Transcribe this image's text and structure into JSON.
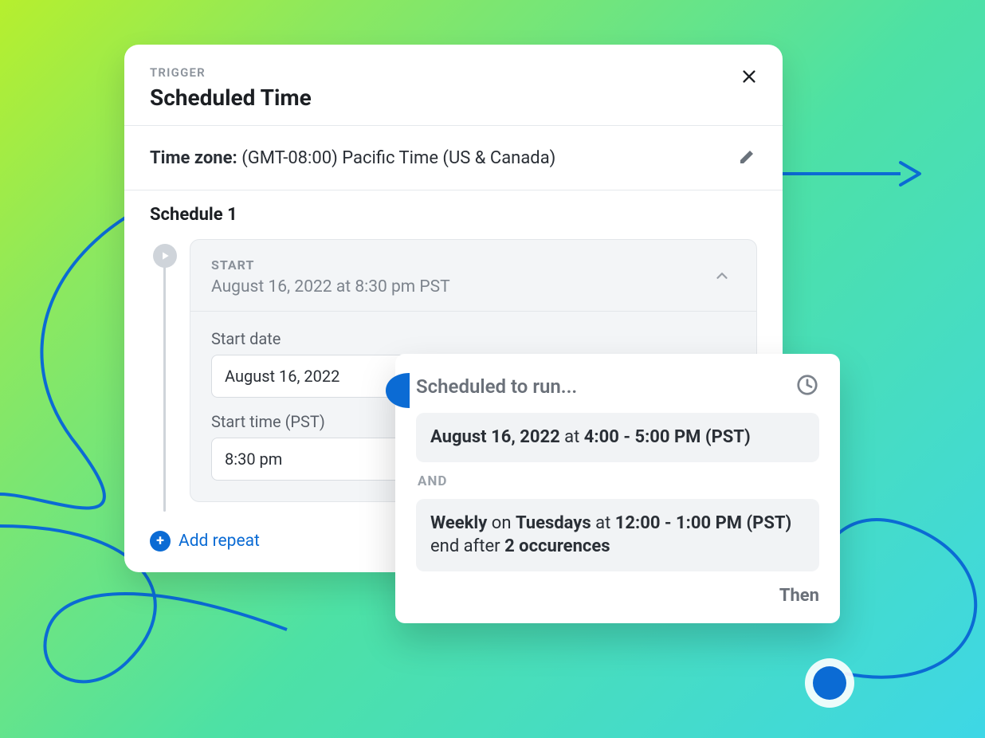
{
  "header": {
    "eyebrow": "TRIGGER",
    "title": "Scheduled Time"
  },
  "timezone": {
    "label": "Time zone:",
    "value": "(GMT-08:00) Pacific Time (US & Canada)"
  },
  "schedule": {
    "section_title": "Schedule 1",
    "start": {
      "eyebrow": "START",
      "summary": "August 16, 2022 at 8:30 pm PST"
    },
    "fields": {
      "start_date_label": "Start date",
      "start_date_value": "August 16, 2022",
      "start_time_label": "Start time (PST)",
      "start_time_value": "8:30 pm"
    },
    "add_repeat_label": "Add repeat"
  },
  "popover": {
    "title": "Scheduled to run...",
    "entry1": {
      "date": "August 16, 2022",
      "at": " at ",
      "time": "4:00 - 5:00 PM (PST)"
    },
    "and_label": "AND",
    "entry2": {
      "weekly": "Weekly",
      "on": " on ",
      "day": "Tuesdays",
      "at": " at ",
      "time": "12:00 - 1:00 PM (PST)",
      "end": " end after ",
      "occ": "2 occurences"
    },
    "then_label": "Then"
  }
}
